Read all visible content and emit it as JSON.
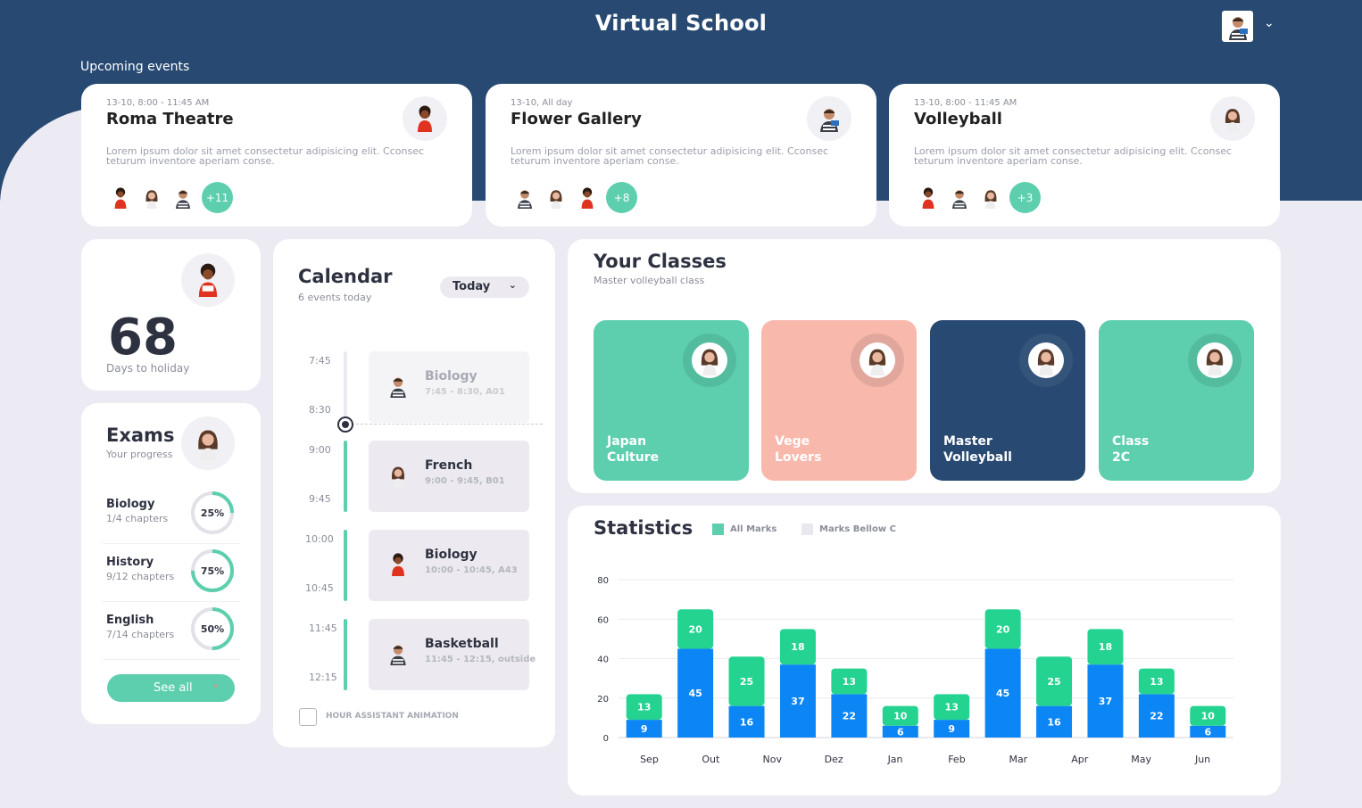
{
  "app": {
    "title": "Virtual School",
    "section_label": "Upcoming events"
  },
  "events": [
    {
      "date": "13-10, 8:00 - 11:45 AM",
      "title": "Roma Theatre",
      "description": "Lorem ipsum dolor sit amet consectetur adipisicing elit. Cconsec teturum inventore aperiam conse.",
      "more": "+11"
    },
    {
      "date": "13-10, All day",
      "title": "Flower Gallery",
      "description": "Lorem ipsum dolor sit amet consectetur adipisicing elit. Cconsec teturum inventore aperiam conse.",
      "more": "+8"
    },
    {
      "date": "13-10, 8:00 - 11:45 AM",
      "title": "Volleyball",
      "description": "Lorem ipsum dolor sit amet consectetur adipisicing elit. Cconsec teturum inventore aperiam conse.",
      "more": "+3"
    }
  ],
  "holiday": {
    "count": "68",
    "label": "Days to holiday"
  },
  "exams": {
    "title": "Exams",
    "subtitle": "Your progress",
    "items": [
      {
        "name": "Biology",
        "chapters": "1/4 chapters",
        "percent_label": "25%",
        "progress": 0.25
      },
      {
        "name": "History",
        "chapters": "9/12 chapters",
        "percent_label": "75%",
        "progress": 0.75
      },
      {
        "name": "English",
        "chapters": "7/14 chapters",
        "percent_label": "50%",
        "progress": 0.5
      }
    ],
    "see_all": "See all"
  },
  "calendar": {
    "title": "Calendar",
    "subtitle": "6 events today",
    "filter": "Today",
    "times": [
      "7:45",
      "8:30",
      "9:00",
      "9:45",
      "10:00",
      "10:45",
      "11:45",
      "12:15"
    ],
    "events": [
      {
        "name": "Biology",
        "time": "7:45 - 8:30, A01",
        "past": true
      },
      {
        "name": "French",
        "time": "9:00 - 9:45, B01",
        "past": false
      },
      {
        "name": "Biology",
        "time": "10:00 - 10:45, A43",
        "past": false
      },
      {
        "name": "Basketball",
        "time": "11:45 - 12:15, outside",
        "past": false
      }
    ],
    "checkbox_label": "HOUR ASSISTANT ANIMATION"
  },
  "classes": {
    "title": "Your Classes",
    "subtitle": "Master volleyball class",
    "items": [
      {
        "line1": "Japan",
        "line2": "Culture",
        "color": "#5dcfae"
      },
      {
        "line1": "Vege",
        "line2": "Lovers",
        "color": "#f9b8ac"
      },
      {
        "line1": "Master",
        "line2": "Volleyball",
        "color": "#284a72"
      },
      {
        "line1": "Class",
        "line2": "2C",
        "color": "#5dcfae"
      }
    ]
  },
  "statistics": {
    "title": "Statistics",
    "legend": [
      {
        "label": "All Marks",
        "color": "#23d38f"
      },
      {
        "label": "Marks Bellow C",
        "color": "#e9e8ef"
      }
    ]
  },
  "chart_data": {
    "type": "bar",
    "stacked": true,
    "categories": [
      "Sep",
      "Out",
      "Nov",
      "Dez",
      "Jan",
      "Feb",
      "Mar",
      "Apr",
      "May",
      "Jun"
    ],
    "series": [
      {
        "color": "#0d86f5",
        "values": [
          9,
          45,
          16,
          37,
          22,
          6,
          9,
          45,
          16,
          37,
          22,
          6
        ]
      },
      {
        "color": "#23d38f",
        "values": [
          13,
          20,
          25,
          18,
          13,
          10,
          13,
          20,
          25,
          18,
          13,
          10
        ]
      }
    ],
    "yticks": [
      0,
      20,
      40,
      60,
      80
    ],
    "ylim": [
      0,
      80
    ],
    "grid": true
  }
}
